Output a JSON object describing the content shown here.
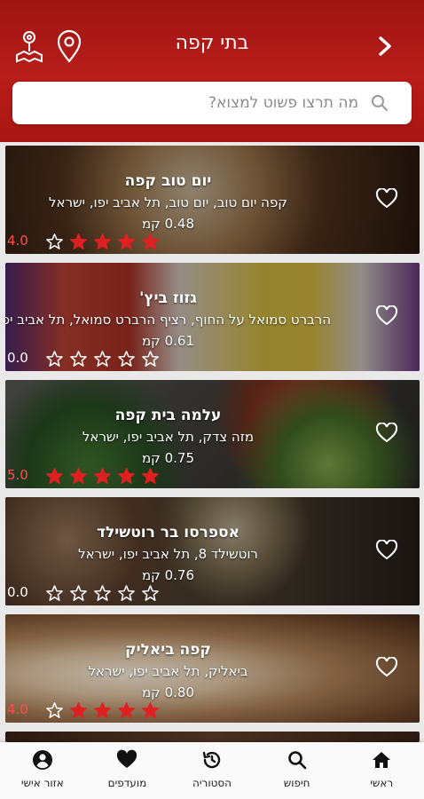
{
  "header": {
    "title": "בתי קפה",
    "back_icon": "chevron-right-icon",
    "map_icon": "map-location-icon",
    "pin_icon": "location-pin-icon"
  },
  "search": {
    "placeholder": "מה תרצו פשוט למצוא?",
    "icon": "search-icon"
  },
  "places": [
    {
      "name": "יום טוב קפה",
      "address": "קפה יום טוב, יום טוב, תל אביב יפו, ישראל",
      "distance": "0.48 קמ",
      "rating": "4.0",
      "stars": 4
    },
    {
      "name": "גזוז ביץ'",
      "address": "הרברט סמואל על החוף, רציף הרברט סמואל, תל אביב יפו, ישראל",
      "distance": "0.61 קמ",
      "rating": "0.0",
      "stars": 0
    },
    {
      "name": "עלמה בית קפה",
      "address": "מזה צדק, תל אביב יפו, ישראל",
      "distance": "0.75 קמ",
      "rating": "5.0",
      "stars": 5
    },
    {
      "name": "אספרסו בר רוטשילד",
      "address": "רוטשילד 8, תל אביב יפו, ישראל",
      "distance": "0.76 קמ",
      "rating": "0.0",
      "stars": 0
    },
    {
      "name": "קפה ביאליק",
      "address": "ביאליק, תל אביב יפו, ישראל",
      "distance": "0.80 קמ",
      "rating": "4.0",
      "stars": 4
    }
  ],
  "bottom_nav": [
    {
      "label": "ראשי",
      "icon": "home-icon"
    },
    {
      "label": "חיפוש",
      "icon": "search-icon"
    },
    {
      "label": "הסטוריה",
      "icon": "history-icon"
    },
    {
      "label": "מועדפים",
      "icon": "heart-icon"
    },
    {
      "label": "אזור אישי",
      "icon": "user-icon"
    }
  ],
  "colors": {
    "header_red": "#b81d19",
    "star_red": "#e02020",
    "rating_red": "#ff4d4d"
  }
}
